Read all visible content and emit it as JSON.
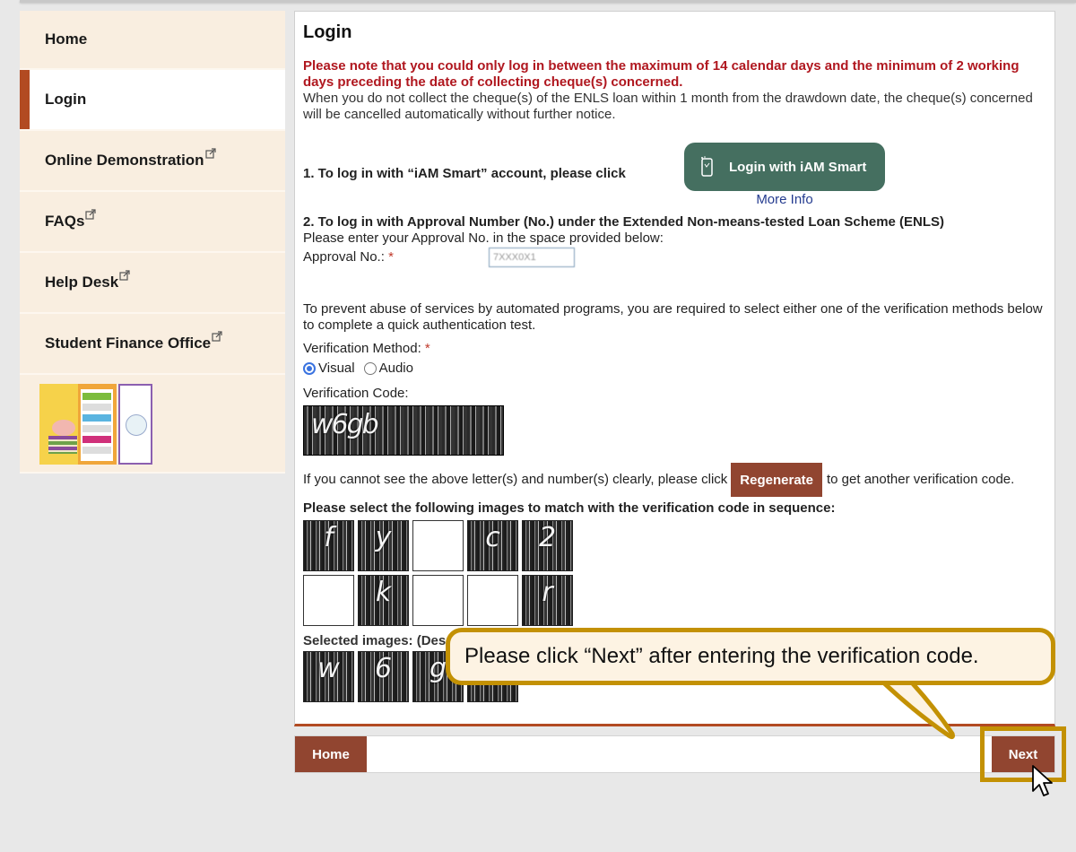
{
  "sidebar": {
    "items": [
      {
        "label": "Home",
        "external": false,
        "active": false
      },
      {
        "label": "Login",
        "external": false,
        "active": true
      },
      {
        "label": "Online Demonstration",
        "external": true,
        "active": false
      },
      {
        "label": "FAQs",
        "external": true,
        "active": false
      },
      {
        "label": "Help Desk",
        "external": true,
        "active": false
      },
      {
        "label": "Student Finance Office",
        "external": true,
        "active": false
      }
    ],
    "banner_alt": "Prudent Financial Management leaflet"
  },
  "main": {
    "title": "Login",
    "notice_red": "Please note that you could only log in between the maximum of 14 calendar days and the minimum of 2 working days preceding the date of collecting cheque(s) concerned.",
    "notice": "When you do not collect the cheque(s) of the ENLS loan within 1 month from the drawdown date, the cheque(s) concerned will be cancelled automatically without further notice.",
    "iam_smart": {
      "label": "1. To log in with “iAM Smart” account, please click",
      "button": "Login with iAM Smart",
      "more_info": "More Info"
    },
    "approval": {
      "section_title": "2. To log in with Approval Number (No.) under the Extended Non-means-tested Loan Scheme (ENLS)",
      "instruction": "Please enter your Approval No. in the space provided below:",
      "label": "Approval No.:",
      "required_mark": "*",
      "value": "7XXX0X1"
    },
    "verification": {
      "abuse_text": "To prevent abuse of services by automated programs, you are required to select either one of the verification methods below to complete a quick authentication test.",
      "method_label": "Verification Method:",
      "required_mark": "*",
      "methods": [
        {
          "label": "Visual",
          "checked": true
        },
        {
          "label": "Audio",
          "checked": false
        }
      ],
      "code_label": "Verification Code:",
      "captcha_text": "w6gb",
      "regen_prefix": "If you cannot see the above letter(s) and number(s) clearly, please click",
      "regen_button": "Regenerate",
      "regen_suffix": "to get another verification code.",
      "select_title": "Please select the following images to match with the verification code in sequence:",
      "tiles": [
        "f",
        "y",
        "",
        "c",
        "2",
        "",
        "k",
        "",
        "",
        "r"
      ],
      "selected_title": "Selected images: (Deselect)",
      "selected": [
        "w",
        "6",
        "g",
        "b"
      ]
    }
  },
  "bottom": {
    "home": "Home",
    "next": "Next"
  },
  "callout": {
    "text": "Please click “Next” after entering the verification code."
  },
  "colors": {
    "accent": "#b24a22",
    "button": "#914530",
    "iam_green": "#456f60",
    "highlight": "#c39104",
    "notice_red": "#b0171f"
  }
}
